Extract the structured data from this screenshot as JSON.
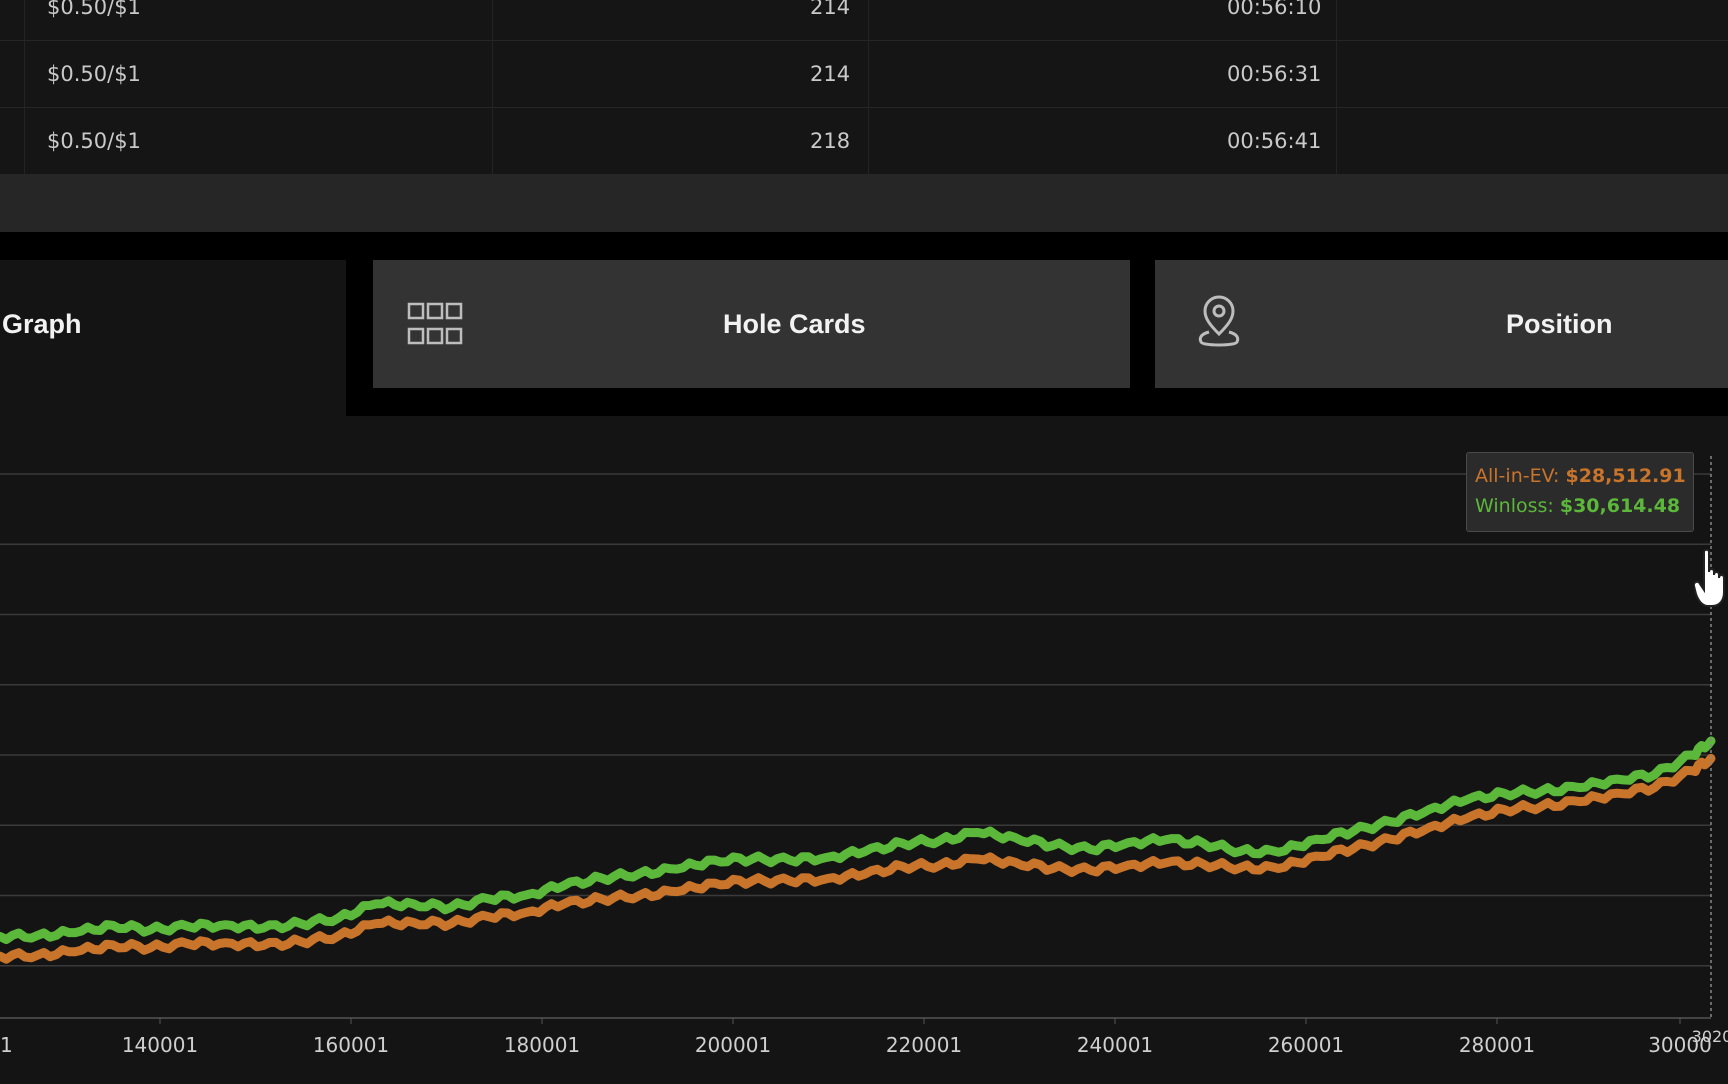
{
  "table": {
    "rows": [
      {
        "stakes": "$0.50/$1",
        "hands": "214",
        "time": "00:56:10"
      },
      {
        "stakes": "$0.50/$1",
        "hands": "214",
        "time": "00:56:31"
      },
      {
        "stakes": "$0.50/$1",
        "hands": "218",
        "time": "00:56:41"
      }
    ]
  },
  "tabs": {
    "graph": "Graph",
    "hole_cards": "Hole Cards",
    "position": "Position"
  },
  "icons": {
    "hole_cards": "grid-icon",
    "position": "map-pin-icon",
    "cursor": "hand-cursor-icon"
  },
  "tooltip": {
    "ev_label": "All-in-EV:",
    "ev_value": "$28,512.91",
    "winloss_label": "Winloss:",
    "winloss_value": "$30,614.48"
  },
  "colors": {
    "winloss": "#5bb83a",
    "allin_ev": "#c9742b",
    "background": "#141414"
  },
  "chart_data": {
    "type": "line",
    "x_tick_labels": [
      "1",
      "140001",
      "160001",
      "180001",
      "200001",
      "220001",
      "240001",
      "260001",
      "280001",
      "30000",
      "3020"
    ],
    "xlim": [
      120001,
      302000
    ],
    "grid": true,
    "series": [
      {
        "name": "Winloss",
        "color": "#5bb83a",
        "x": [
          120001,
          124000,
          128000,
          132000,
          136000,
          140000,
          144000,
          148000,
          152000,
          156000,
          160000,
          164000,
          168000,
          172000,
          176000,
          180000,
          184000,
          188000,
          192000,
          196000,
          200000,
          204000,
          208000,
          212000,
          216000,
          220000,
          224000,
          228000,
          232000,
          236000,
          240000,
          244000,
          248000,
          252000,
          256000,
          260000,
          264000,
          268000,
          272000,
          276000,
          280000,
          284000,
          288000,
          292000,
          296000,
          300000,
          302000
        ],
        "values": [
          0.145,
          0.147,
          0.152,
          0.165,
          0.157,
          0.163,
          0.166,
          0.16,
          0.168,
          0.178,
          0.203,
          0.203,
          0.197,
          0.212,
          0.219,
          0.236,
          0.249,
          0.257,
          0.265,
          0.281,
          0.283,
          0.281,
          0.286,
          0.296,
          0.311,
          0.316,
          0.33,
          0.321,
          0.307,
          0.3,
          0.312,
          0.317,
          0.311,
          0.297,
          0.295,
          0.318,
          0.333,
          0.349,
          0.371,
          0.388,
          0.4,
          0.404,
          0.41,
          0.425,
          0.433,
          0.468,
          0.493
        ]
      },
      {
        "name": "All-in-EV",
        "color": "#c9742b",
        "x": [
          120001,
          124000,
          128000,
          132000,
          136000,
          140000,
          144000,
          148000,
          152000,
          156000,
          160000,
          164000,
          168000,
          172000,
          176000,
          180000,
          184000,
          188000,
          192000,
          196000,
          200000,
          204000,
          208000,
          212000,
          216000,
          220000,
          224000,
          228000,
          232000,
          236000,
          240000,
          244000,
          248000,
          252000,
          256000,
          260000,
          264000,
          268000,
          272000,
          276000,
          280000,
          284000,
          288000,
          292000,
          296000,
          300000,
          302000
        ],
        "values": [
          0.11,
          0.112,
          0.118,
          0.13,
          0.125,
          0.132,
          0.134,
          0.129,
          0.136,
          0.146,
          0.168,
          0.17,
          0.168,
          0.18,
          0.188,
          0.203,
          0.212,
          0.218,
          0.225,
          0.24,
          0.244,
          0.244,
          0.248,
          0.256,
          0.27,
          0.272,
          0.283,
          0.277,
          0.266,
          0.263,
          0.272,
          0.276,
          0.274,
          0.268,
          0.266,
          0.288,
          0.302,
          0.318,
          0.339,
          0.355,
          0.371,
          0.377,
          0.385,
          0.4,
          0.41,
          0.44,
          0.462
        ]
      }
    ]
  }
}
